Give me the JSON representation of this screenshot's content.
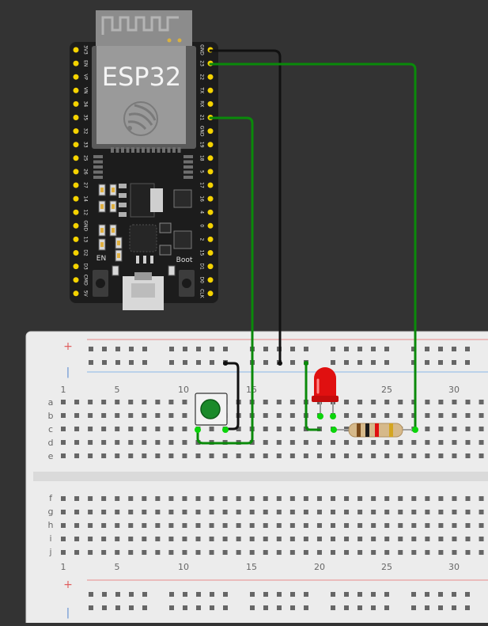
{
  "canvas_bg": "#333333",
  "esp32": {
    "title": "ESP32",
    "left_pins": [
      "3V3",
      "EN",
      "VP",
      "VN",
      "34",
      "35",
      "32",
      "33",
      "25",
      "26",
      "27",
      "14",
      "12",
      "GND",
      "13",
      "D2",
      "D3",
      "CMD",
      "5V"
    ],
    "right_pins": [
      "GND",
      "23",
      "22",
      "TX",
      "RX",
      "21",
      "GND",
      "19",
      "18",
      "5",
      "17",
      "16",
      "4",
      "0",
      "2",
      "15",
      "D1",
      "D0",
      "CLK"
    ],
    "en_label": "EN",
    "boot_label": "Boot"
  },
  "breadboard": {
    "plus_sign": "+",
    "minus_sign": "|",
    "top_column_numbers": [
      "1",
      "5",
      "10",
      "15",
      "20",
      "25",
      "30"
    ],
    "bottom_column_numbers": [
      "1",
      "5",
      "10",
      "15",
      "20",
      "25",
      "30"
    ],
    "top_row_letters": [
      "a",
      "b",
      "c",
      "d",
      "e"
    ],
    "bottom_row_letters": [
      "f",
      "g",
      "h",
      "i",
      "j"
    ]
  },
  "colors": {
    "wire_green": "#0a8a0a",
    "wire_black": "#111111",
    "pin_yellow": "#f5d300",
    "led_red": "#e01010",
    "button_green": "#1a8a2a",
    "rail_red": "#e88a8a",
    "rail_blue": "#8ab8e8"
  },
  "components": {
    "led": "red-led",
    "resistor": "resistor",
    "pushbutton": "green-pushbutton"
  }
}
